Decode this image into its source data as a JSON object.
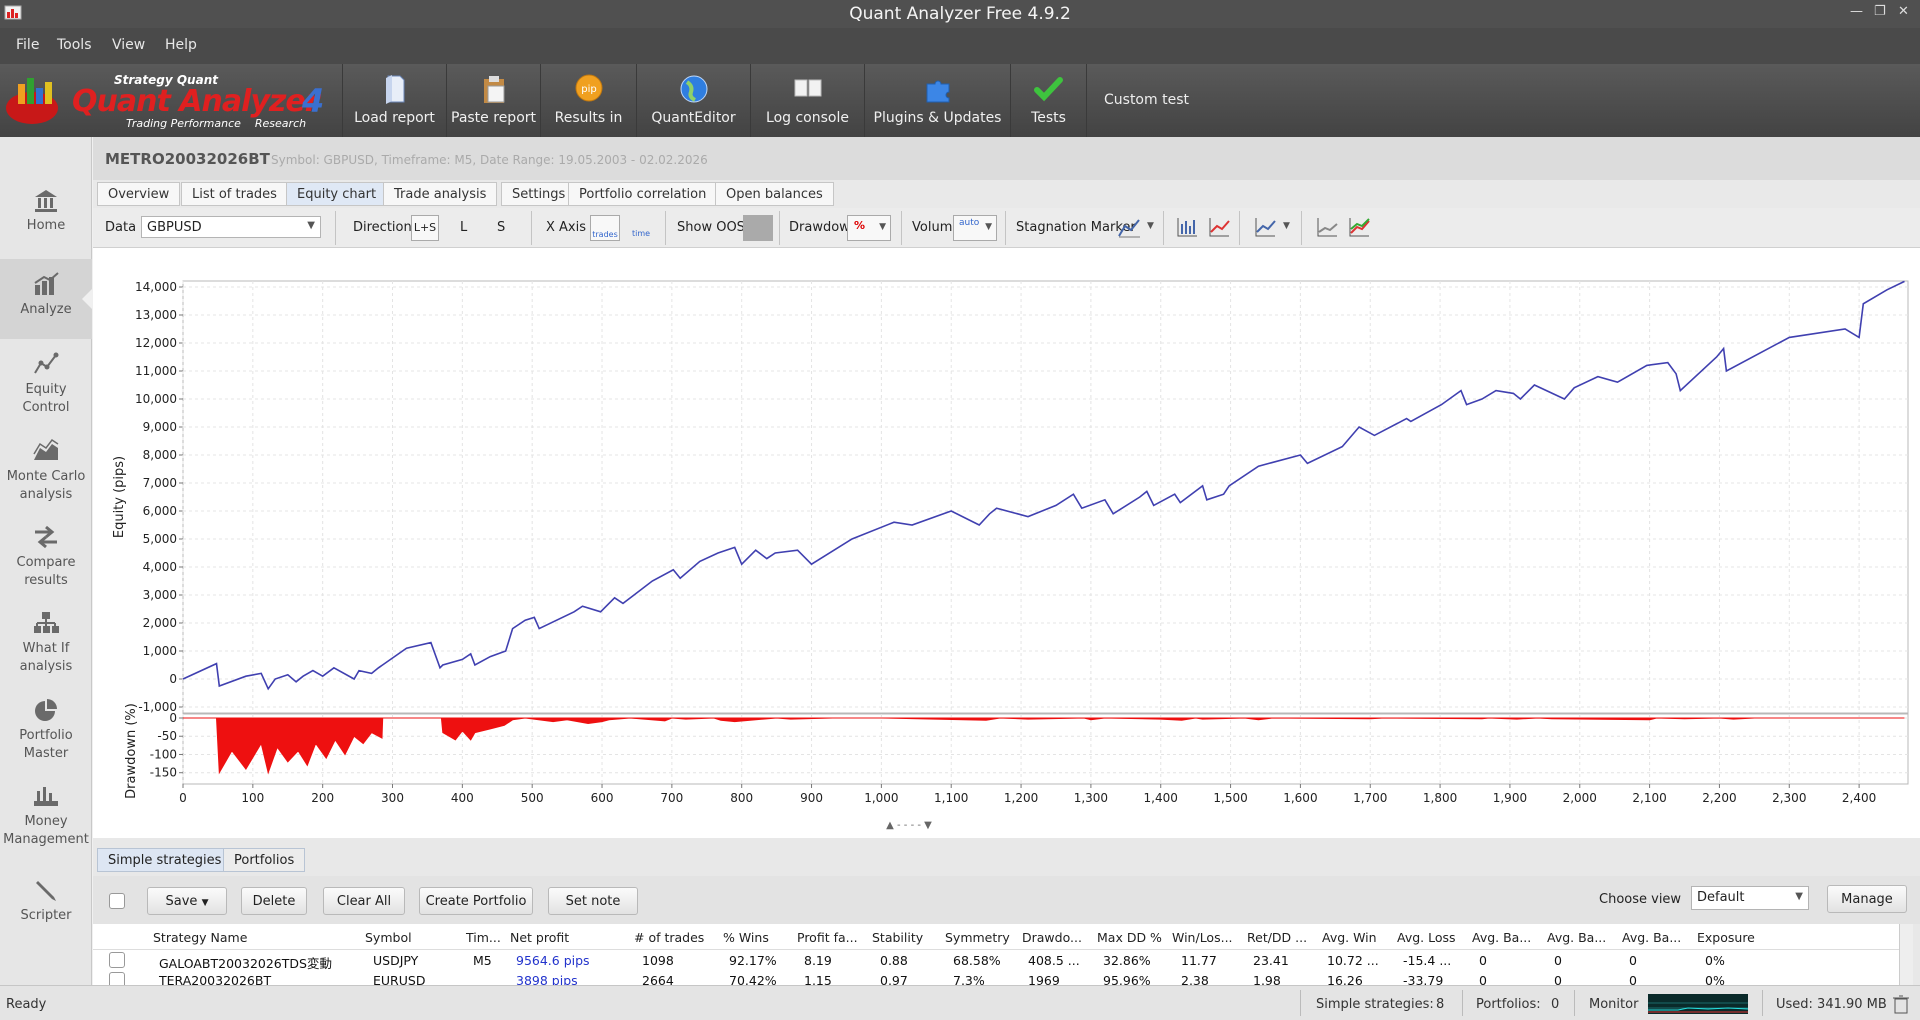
{
  "app": {
    "title": "Quant Analyzer Free 4.9.2"
  },
  "menu": [
    "File",
    "Tools",
    "View",
    "Help"
  ],
  "logo": {
    "brand_top": "Strategy Quant",
    "brand_main": "Quant Analyzer",
    "version_mark": "4",
    "tagline": "Trading Performance    Research"
  },
  "toolbar": {
    "buttons": [
      {
        "label": "Load report",
        "icon": "load-report-icon"
      },
      {
        "label": "Paste report",
        "icon": "paste-report-icon"
      },
      {
        "label": "Results in",
        "icon": "results-in-icon"
      },
      {
        "label": "QuantEditor",
        "icon": "globe-icon"
      },
      {
        "label": "Log console",
        "icon": "log-console-icon"
      },
      {
        "label": "Plugins & Updates",
        "icon": "puzzle-icon"
      },
      {
        "label": "Tests",
        "icon": "checkmark-icon"
      }
    ],
    "custom_test": "Custom test"
  },
  "sidebar": {
    "items": [
      {
        "label": "Home",
        "icon": "home-icon"
      },
      {
        "label": "Analyze",
        "icon": "analyze-chart-icon",
        "active": true
      },
      {
        "label": "Equity\nControl",
        "icon": "equity-control-icon"
      },
      {
        "label": "Monte Carlo\nanalysis",
        "icon": "monte-carlo-icon"
      },
      {
        "label": "Compare\nresults",
        "icon": "compare-icon"
      },
      {
        "label": "What If\nanalysis",
        "icon": "what-if-icon"
      },
      {
        "label": "Portfolio\nMaster",
        "icon": "pie-chart-icon"
      },
      {
        "label": "Money\nManagement",
        "icon": "money-icon"
      },
      {
        "label": "Scripter",
        "icon": "pencil-icon"
      }
    ]
  },
  "report": {
    "name": "METRO20032026BT",
    "meta": "Symbol: GBPUSD, Timeframe: M5, Date Range: 19.05.2003 - 02.02.2026"
  },
  "tabs": [
    {
      "label": "Overview"
    },
    {
      "label": "List of trades"
    },
    {
      "label": "Equity chart",
      "active": true
    },
    {
      "label": "Trade analysis"
    },
    {
      "label": "Settings"
    },
    {
      "label": "Portfolio correlation"
    },
    {
      "label": "Open balances"
    }
  ],
  "chart_toolbar": {
    "data_label": "Data",
    "data_value": "GBPUSD",
    "direction_label": "Direction",
    "direction_options": [
      "L+S",
      "L",
      "S"
    ],
    "xaxis_label": "X Axis",
    "xaxis_trades": "trades",
    "xaxis_time": "time",
    "show_oos_label": "Show OOS",
    "drawdown_label": "Drawdown",
    "drawdown_value": "%",
    "volume_label": "Volume",
    "volume_value": "auto",
    "stagnation_label": "Stagnation Marker"
  },
  "chart_data": [
    {
      "type": "line",
      "ylabel": "Equity (pips)",
      "xlim": [
        0,
        2470
      ],
      "ylim": [
        -1000,
        14000
      ],
      "yticks": [
        14000,
        13000,
        12000,
        11000,
        10000,
        9000,
        8000,
        7000,
        6000,
        5000,
        4000,
        3000,
        2000,
        1000,
        0,
        -1000
      ],
      "ytick_labels": [
        "14,000",
        "13,000",
        "12,000",
        "11,000",
        "10,000",
        "9,000",
        "8,000",
        "7,000",
        "6,000",
        "5,000",
        "4,000",
        "3,000",
        "2,000",
        "1,000",
        "0",
        "-1,000"
      ],
      "grid": true,
      "series": [
        {
          "color": "#4040b0",
          "x": [
            0,
            48,
            52,
            90,
            112,
            122,
            132,
            150,
            162,
            172,
            186,
            200,
            216,
            245,
            252,
            270,
            280,
            320,
            355,
            368,
            372,
            400,
            412,
            418,
            440,
            462,
            472,
            490,
            503,
            510,
            560,
            572,
            598,
            618,
            630,
            672,
            702,
            712,
            740,
            766,
            790,
            800,
            820,
            836,
            848,
            880,
            900,
            958,
            1018,
            1044,
            1100,
            1140,
            1155,
            1165,
            1210,
            1250,
            1275,
            1287,
            1320,
            1332,
            1370,
            1380,
            1390,
            1420,
            1428,
            1460,
            1466,
            1490,
            1498,
            1540,
            1600,
            1610,
            1660,
            1684,
            1706,
            1752,
            1758,
            1802,
            1830,
            1838,
            1860,
            1880,
            1905,
            1915,
            1935,
            1978,
            1992,
            2026,
            2054,
            2096,
            2126,
            2138,
            2144,
            2196,
            2206,
            2210,
            2300,
            2380,
            2400,
            2406,
            2440,
            2465
          ],
          "y": [
            0,
            550,
            -250,
            100,
            200,
            -350,
            0,
            150,
            -100,
            100,
            300,
            100,
            400,
            0,
            300,
            200,
            400,
            1100,
            1300,
            400,
            500,
            700,
            900,
            500,
            800,
            1000,
            1800,
            2100,
            2200,
            1800,
            2400,
            2600,
            2400,
            2900,
            2700,
            3500,
            3900,
            3600,
            4200,
            4500,
            4700,
            4100,
            4600,
            4300,
            4500,
            4600,
            4100,
            5000,
            5600,
            5500,
            6000,
            5500,
            5900,
            6100,
            5800,
            6200,
            6600,
            6100,
            6400,
            5900,
            6500,
            6700,
            6200,
            6600,
            6300,
            6900,
            6400,
            6600,
            6900,
            7600,
            8000,
            7700,
            8300,
            9000,
            8700,
            9300,
            9200,
            9800,
            10300,
            9800,
            10000,
            10300,
            10200,
            10000,
            10500,
            10000,
            10400,
            10800,
            10600,
            11200,
            11300,
            10900,
            10300,
            11500,
            11800,
            11000,
            12200,
            12500,
            12200,
            13400,
            13900,
            14200
          ]
        }
      ]
    },
    {
      "type": "area",
      "ylabel": "Drawdown (%)",
      "xlim": [
        0,
        2470
      ],
      "ylim": [
        -170,
        0
      ],
      "yticks": [
        0,
        -50,
        -100,
        -150
      ],
      "ytick_labels": [
        "0",
        "-50",
        "-100",
        "-150"
      ],
      "xticks": [
        0,
        100,
        200,
        300,
        400,
        500,
        600,
        700,
        800,
        900,
        1000,
        1100,
        1200,
        1300,
        1400,
        1500,
        1600,
        1700,
        1800,
        1900,
        2000,
        2100,
        2200,
        2300,
        2400
      ],
      "xtick_labels": [
        "0",
        "100",
        "200",
        "300",
        "400",
        "500",
        "600",
        "700",
        "800",
        "900",
        "1,000",
        "1,100",
        "1,200",
        "1,300",
        "1,400",
        "1,500",
        "1,600",
        "1,700",
        "1,800",
        "1,900",
        "2,000",
        "2,100",
        "2,200",
        "2,300",
        "2,400"
      ],
      "grid": true,
      "series": [
        {
          "color": "#ee1010",
          "x": [
            0,
            48,
            52,
            70,
            90,
            112,
            122,
            135,
            150,
            165,
            178,
            190,
            205,
            218,
            232,
            245,
            258,
            270,
            285,
            286,
            370,
            372,
            390,
            400,
            412,
            418,
            440,
            460,
            472,
            490,
            530,
            550,
            580,
            600,
            610,
            640,
            690,
            700,
            720,
            760,
            770,
            790,
            850,
            870,
            930,
            1000,
            1150,
            1170,
            1210,
            1290,
            1300,
            1320,
            1400,
            1430,
            1450,
            1460,
            1520,
            1540,
            1560,
            1700,
            1720,
            1860,
            1870,
            1910,
            1940,
            1960,
            2100,
            2110,
            2150,
            2200,
            2220,
            2250,
            2465
          ],
          "y": [
            0,
            0,
            -150,
            -90,
            -140,
            -70,
            -150,
            -80,
            -120,
            -90,
            -130,
            -70,
            -110,
            -60,
            -100,
            -50,
            -70,
            -40,
            -55,
            0,
            0,
            -40,
            -60,
            -35,
            -60,
            -40,
            -30,
            -20,
            -5,
            0,
            -10,
            -5,
            -15,
            -10,
            -5,
            0,
            -8,
            0,
            -3,
            0,
            -6,
            -10,
            0,
            -3,
            0,
            0,
            -6,
            0,
            -3,
            0,
            -5,
            0,
            -3,
            -6,
            0,
            -3,
            0,
            -5,
            0,
            -2,
            0,
            -2,
            0,
            -3,
            0,
            -2,
            -5,
            0,
            -2,
            0,
            -3,
            0,
            0
          ]
        }
      ]
    }
  ],
  "bottom": {
    "tabs": [
      "Simple strategies",
      "Portfolios"
    ],
    "buttons": {
      "save": "Save",
      "delete": "Delete",
      "clear_all": "Clear All",
      "create_portfolio": "Create Portfolio",
      "set_note": "Set note",
      "manage": "Manage"
    },
    "choose_view_label": "Choose view",
    "choose_view_value": "Default",
    "columns": [
      "Strategy Name",
      "Symbol",
      "Tim...",
      "Net profit",
      "# of trades",
      "% Wins",
      "Profit fa...",
      "Stability",
      "Symmetry",
      "Drawdo...",
      "Max DD %",
      "Win/Los...",
      "Ret/DD ...",
      "Avg. Win",
      "Avg. Loss",
      "Avg. Ba...",
      "Avg. Ba...",
      "Avg. Ba...",
      "Exposure"
    ],
    "rows": [
      [
        "GALOABT20032026TDS変動",
        "USDJPY",
        "M5",
        "9564.6 pips",
        "1098",
        "92.17%",
        "8.19",
        "0.88",
        "68.58%",
        "408.5 ...",
        "32.86%",
        "11.77",
        "23.41",
        "10.72 ...",
        "-15.4 ...",
        "0",
        "0",
        "0",
        "0%"
      ],
      [
        "TERA20032026BT",
        "EURUSD",
        "",
        "3898 pips",
        "2664",
        "70.42%",
        "1.15",
        "0.97",
        "7.3%",
        "1969",
        "95.96%",
        "2.38",
        "1.98",
        "16.26",
        "-33.79",
        "0",
        "0",
        "0",
        "0%"
      ]
    ]
  },
  "statusbar": {
    "ready": "Ready",
    "simple_label": "Simple strategies:",
    "simple_count": "8",
    "portfolios_label": "Portfolios:",
    "portfolios_count": "0",
    "monitor": "Monitor",
    "memory": "Used: 341.90 MB"
  }
}
